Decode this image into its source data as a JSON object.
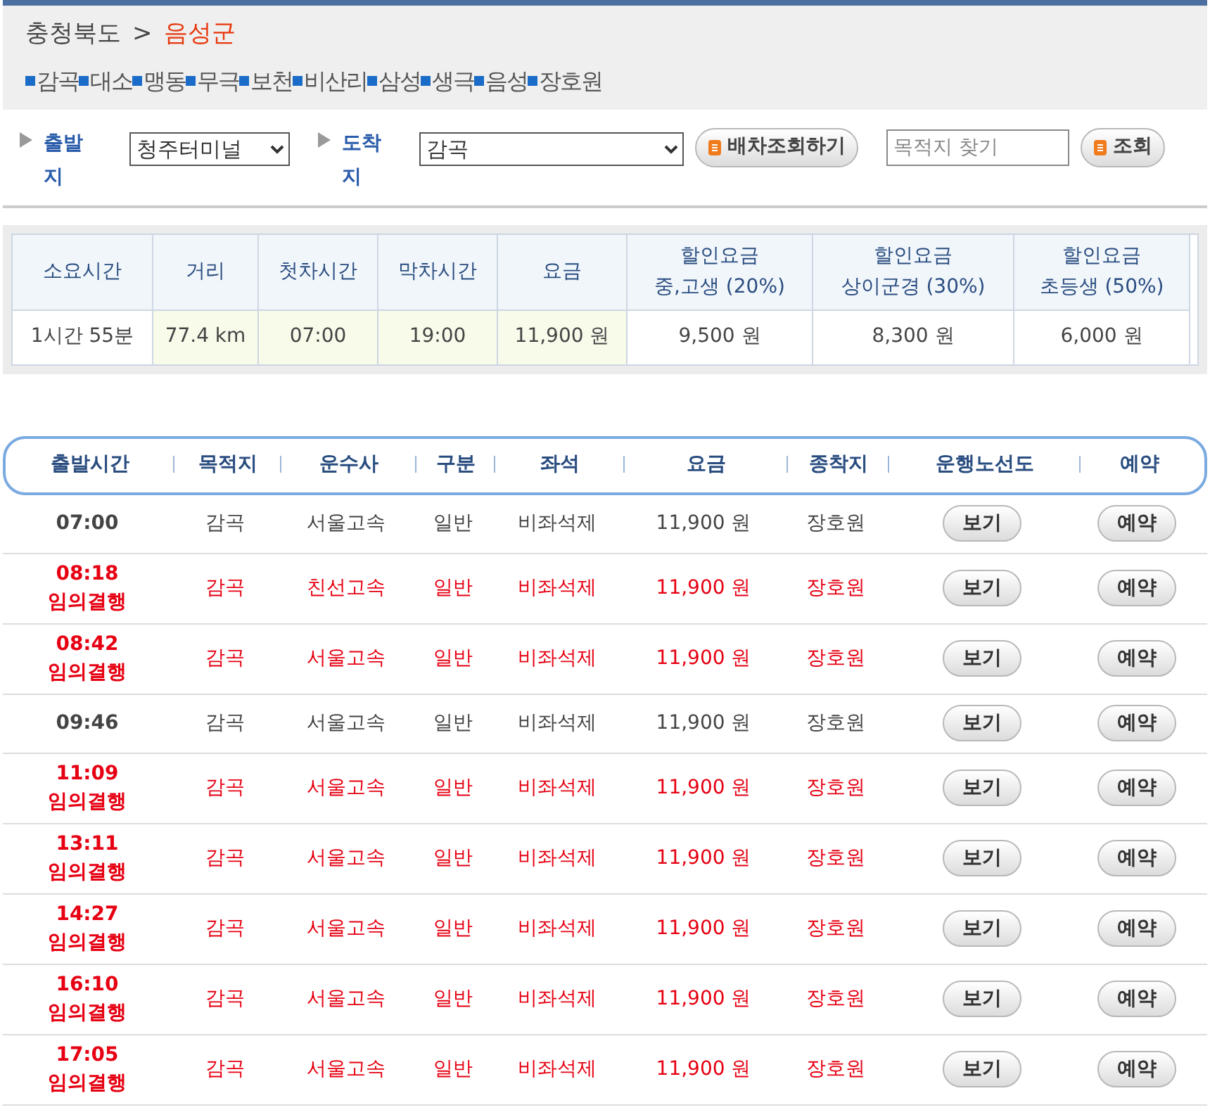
{
  "breadcrumb": {
    "province": "충청북도",
    "separator": ">",
    "county": "음성군"
  },
  "towns": [
    "감곡",
    "대소",
    "맹동",
    "무극",
    "보천",
    "비산리",
    "삼성",
    "생극",
    "음성",
    "장호원"
  ],
  "search_form": {
    "departure_label": "출발지",
    "departure_value": "청주터미널",
    "arrival_label": "도착지",
    "arrival_value": "감곡",
    "lookup_button": "배차조회하기",
    "destination_placeholder": "목적지 찾기",
    "find_button": "조회"
  },
  "summary": {
    "columns": [
      "소요시간",
      "거리",
      "첫차시간",
      "막차시간",
      "요금",
      "할인요금\n중,고생 (20%)",
      "할인요금\n상이군경 (30%)",
      "할인요금\n초등생 (50%)"
    ],
    "row": [
      "1시간 55분",
      "77.4 km",
      "07:00",
      "19:00",
      "11,900 원",
      "9,500 원",
      "8,300 원",
      "6,000 원"
    ]
  },
  "schedule": {
    "columns": [
      "출발시간",
      "목적지",
      "운수사",
      "구분",
      "좌석",
      "요금",
      "종착지",
      "운행노선도",
      "예약"
    ],
    "rows": [
      {
        "time": "07:00",
        "note": null,
        "highlight": false,
        "destination": "감곡",
        "company": "서울고속",
        "class": "일반",
        "seat": "비좌석제",
        "fare": "11,900 원",
        "terminal": "장호원",
        "map_button": "보기",
        "reserve_button": "예약"
      },
      {
        "time": "08:18",
        "note": "임의결행",
        "highlight": true,
        "destination": "감곡",
        "company": "친선고속",
        "class": "일반",
        "seat": "비좌석제",
        "fare": "11,900 원",
        "terminal": "장호원",
        "map_button": "보기",
        "reserve_button": "예약"
      },
      {
        "time": "08:42",
        "note": "임의결행",
        "highlight": true,
        "destination": "감곡",
        "company": "서울고속",
        "class": "일반",
        "seat": "비좌석제",
        "fare": "11,900 원",
        "terminal": "장호원",
        "map_button": "보기",
        "reserve_button": "예약"
      },
      {
        "time": "09:46",
        "note": null,
        "highlight": false,
        "destination": "감곡",
        "company": "서울고속",
        "class": "일반",
        "seat": "비좌석제",
        "fare": "11,900 원",
        "terminal": "장호원",
        "map_button": "보기",
        "reserve_button": "예약"
      },
      {
        "time": "11:09",
        "note": "임의결행",
        "highlight": true,
        "destination": "감곡",
        "company": "서울고속",
        "class": "일반",
        "seat": "비좌석제",
        "fare": "11,900 원",
        "terminal": "장호원",
        "map_button": "보기",
        "reserve_button": "예약"
      },
      {
        "time": "13:11",
        "note": "임의결행",
        "highlight": true,
        "destination": "감곡",
        "company": "서울고속",
        "class": "일반",
        "seat": "비좌석제",
        "fare": "11,900 원",
        "terminal": "장호원",
        "map_button": "보기",
        "reserve_button": "예약"
      },
      {
        "time": "14:27",
        "note": "임의결행",
        "highlight": true,
        "destination": "감곡",
        "company": "서울고속",
        "class": "일반",
        "seat": "비좌석제",
        "fare": "11,900 원",
        "terminal": "장호원",
        "map_button": "보기",
        "reserve_button": "예약"
      },
      {
        "time": "16:10",
        "note": "임의결행",
        "highlight": true,
        "destination": "감곡",
        "company": "서울고속",
        "class": "일반",
        "seat": "비좌석제",
        "fare": "11,900 원",
        "terminal": "장호원",
        "map_button": "보기",
        "reserve_button": "예약"
      },
      {
        "time": "17:05",
        "note": "임의결행",
        "highlight": true,
        "destination": "감곡",
        "company": "서울고속",
        "class": "일반",
        "seat": "비좌석제",
        "fare": "11,900 원",
        "terminal": "장호원",
        "map_button": "보기",
        "reserve_button": "예약"
      }
    ]
  }
}
